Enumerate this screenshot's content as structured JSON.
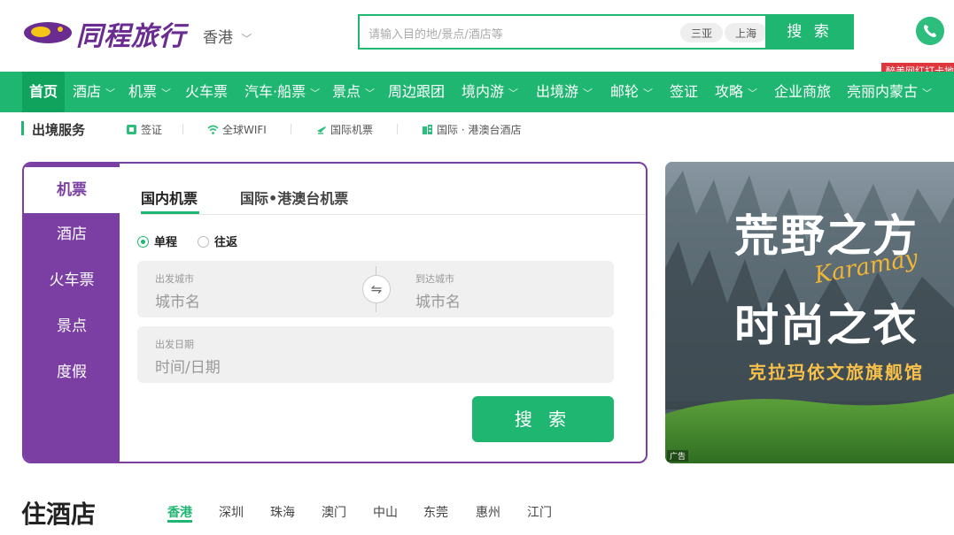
{
  "header": {
    "brand": "同程旅行",
    "city": "香港",
    "search_placeholder": "请输入目的地/景点/酒店等",
    "chips": [
      "三亚",
      "上海"
    ],
    "search_button": "搜 索",
    "promo_tag": "醉美网红打卡地"
  },
  "nav": [
    {
      "label": "首页",
      "chevron": false
    },
    {
      "label": "酒店",
      "chevron": true
    },
    {
      "label": "机票",
      "chevron": true
    },
    {
      "label": "火车票",
      "chevron": false
    },
    {
      "label": "汽车·船票",
      "chevron": true
    },
    {
      "label": "景点",
      "chevron": true
    },
    {
      "label": "周边跟团",
      "chevron": false
    },
    {
      "label": "境内游",
      "chevron": true
    },
    {
      "label": "出境游",
      "chevron": true
    },
    {
      "label": "邮轮",
      "chevron": true
    },
    {
      "label": "签证",
      "chevron": false
    },
    {
      "label": "攻略",
      "chevron": true
    },
    {
      "label": "企业商旅",
      "chevron": false
    },
    {
      "label": "亮丽内蒙古",
      "chevron": true
    }
  ],
  "subnav": {
    "title": "出境服务",
    "items": [
      {
        "label": "签证",
        "icon": "visa-icon"
      },
      {
        "label": "全球WIFI",
        "icon": "wifi-icon"
      },
      {
        "label": "国际机票",
        "icon": "plane-icon"
      },
      {
        "label": "国际 · 港澳台酒店",
        "icon": "hotel-icon"
      }
    ]
  },
  "booking": {
    "side": [
      "机票",
      "酒店",
      "火车票",
      "景点",
      "度假"
    ],
    "tabs": [
      "国内机票",
      "国际•港澳台机票"
    ],
    "trip_types": [
      "单程",
      "往返"
    ],
    "from_label": "出发城市",
    "from_placeholder": "城市名",
    "to_label": "到达城市",
    "to_placeholder": "城市名",
    "date_label": "出发日期",
    "date_placeholder": "时间/日期",
    "swap_symbol": "⇋",
    "button": "搜 索"
  },
  "banner": {
    "line1": "荒野之方",
    "line2": "时尚之衣",
    "script": "Karamay",
    "caption": "克拉玛依文旅旗舰馆",
    "badge": "广告"
  },
  "hotels": {
    "title": "住酒店",
    "cities": [
      "香港",
      "深圳",
      "珠海",
      "澳门",
      "中山",
      "东莞",
      "惠州",
      "江门"
    ]
  }
}
